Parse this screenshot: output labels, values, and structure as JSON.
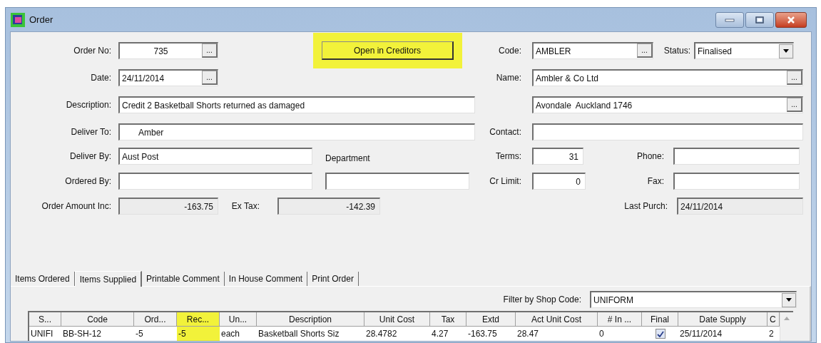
{
  "window": {
    "title": "Order"
  },
  "order_no": {
    "label": "Order No:",
    "value": "735",
    "button": "..."
  },
  "open_button": {
    "label": "Open in Creditors",
    "highlighted": true
  },
  "code": {
    "label": "Code:",
    "value": "AMBLER",
    "button": "..."
  },
  "status": {
    "label": "Status:",
    "value": "Finalised"
  },
  "date": {
    "label": "Date:",
    "value": "24/11/2014",
    "button": "..."
  },
  "name": {
    "label": "Name:",
    "value": "Ambler & Co Ltd",
    "button": "..."
  },
  "description": {
    "label": "Description:",
    "value": "Credit 2 Basketball Shorts returned as damaged"
  },
  "address": {
    "value": "Avondale  Auckland 1746",
    "button": "..."
  },
  "deliver_to": {
    "label": "Deliver To:",
    "value": "Amber"
  },
  "contact": {
    "label": "Contact:"
  },
  "deliver_by": {
    "label": "Deliver By:",
    "value": "Aust Post"
  },
  "department": {
    "label": "Department"
  },
  "terms": {
    "label": "Terms:",
    "value": "31"
  },
  "phone": {
    "label": "Phone:"
  },
  "ordered_by": {
    "label": "Ordered By:"
  },
  "cr_limit": {
    "label": "Cr Limit:",
    "value": "0"
  },
  "fax": {
    "label": "Fax:"
  },
  "order_amount_inc": {
    "label": "Order Amount Inc:",
    "value": "-163.75"
  },
  "ex_tax": {
    "label": "Ex Tax:",
    "value": "-142.39"
  },
  "last_purch": {
    "label": "Last Purch:",
    "value": "24/11/2014"
  },
  "tabs": [
    {
      "label": "Items Ordered",
      "selected": false
    },
    {
      "label": "Items Supplied",
      "selected": true
    },
    {
      "label": "Printable Comment",
      "selected": false
    },
    {
      "label": "In House Comment",
      "selected": false
    },
    {
      "label": "Print Order",
      "selected": false
    }
  ],
  "filter": {
    "label": "Filter by Shop Code:",
    "value": "UNIFORM"
  },
  "table": {
    "columns": [
      {
        "label": "S...",
        "highlighted": false
      },
      {
        "label": "Code",
        "highlighted": false
      },
      {
        "label": "Ord...",
        "highlighted": false
      },
      {
        "label": "Rec...",
        "highlighted": true
      },
      {
        "label": "Un...",
        "highlighted": false
      },
      {
        "label": "Description",
        "highlighted": false
      },
      {
        "label": "Unit Cost",
        "highlighted": false
      },
      {
        "label": "Tax",
        "highlighted": false
      },
      {
        "label": "Extd",
        "highlighted": false
      },
      {
        "label": "Act Unit Cost",
        "highlighted": false
      },
      {
        "label": "# In ...",
        "highlighted": false
      },
      {
        "label": "Final",
        "highlighted": false
      },
      {
        "label": "Date Supply",
        "highlighted": false
      },
      {
        "label": "C",
        "highlighted": false
      }
    ],
    "rows": [
      {
        "cells": [
          {
            "kind": "text",
            "text": "UNIFI"
          },
          {
            "kind": "text",
            "text": "BB-SH-12"
          },
          {
            "kind": "text",
            "text": "-5"
          },
          {
            "kind": "text",
            "text": "-5"
          },
          {
            "kind": "text",
            "text": "each"
          },
          {
            "kind": "text",
            "text": "Basketball Shorts Siz"
          },
          {
            "kind": "text",
            "text": "28.4782"
          },
          {
            "kind": "text",
            "text": "4.27"
          },
          {
            "kind": "text",
            "text": "-163.75"
          },
          {
            "kind": "text",
            "text": "28.47"
          },
          {
            "kind": "text",
            "text": "0"
          },
          {
            "kind": "checkbox",
            "checked": true
          },
          {
            "kind": "text",
            "text": "25/11/2014"
          },
          {
            "kind": "text",
            "text": "2"
          }
        ]
      }
    ]
  }
}
